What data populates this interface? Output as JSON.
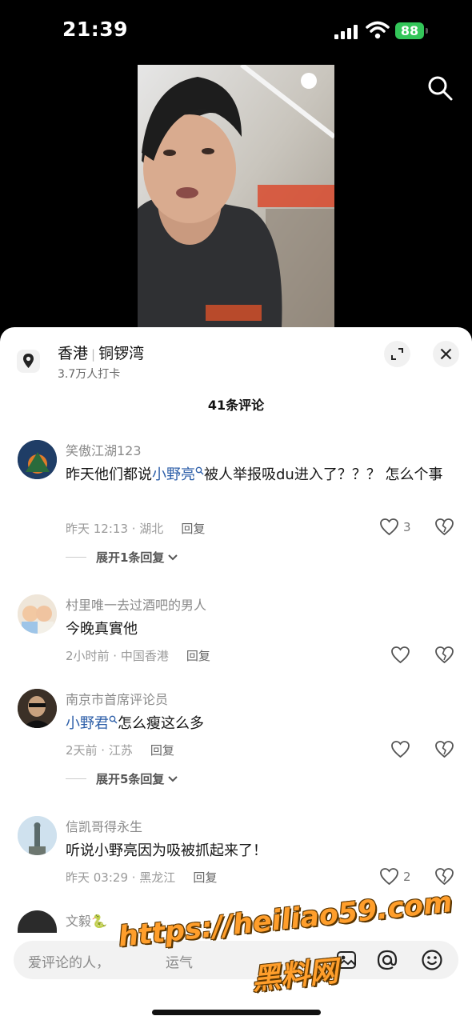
{
  "status": {
    "time": "21:39",
    "battery": "88"
  },
  "location": {
    "city": "香港",
    "district": "铜锣湾",
    "checkins": "3.7万人打卡"
  },
  "comments_title": "41条评论",
  "comments": [
    {
      "user": "笑傲江湖123",
      "text_before": "昨天他们都说",
      "mention": "小野亮",
      "text_after": "被人举报吸du进入了？？？ 怎么个事",
      "time_loc": "昨天 12:13 · 湖北",
      "reply": "回复",
      "likes": "3",
      "expand": "展开1条回复"
    },
    {
      "user": "村里唯一去过酒吧的男人",
      "text": "今晚真實他",
      "time_loc": "2小时前 · 中国香港",
      "reply": "回复"
    },
    {
      "user": "南京市首席评论员",
      "mention": "小野君",
      "text_after": "怎么瘦这么多",
      "time_loc": "2天前 · 江苏",
      "reply": "回复",
      "expand": "展开5条回复"
    },
    {
      "user": "信凯哥得永生",
      "text": "听说小野亮因为吸被抓起来了！",
      "time_loc": "昨天 03:29 · 黑龙江",
      "reply": "回复",
      "likes": "2"
    },
    {
      "user": "文毅🐍"
    }
  ],
  "input": {
    "placeholder": "爱评论的人，",
    "placeholder_tail": "运气"
  },
  "watermark": {
    "url": "https://heiliao59.com",
    "name": "黑料网"
  },
  "icons": [
    "signal-icon",
    "wifi-icon",
    "search-icon",
    "location-pin-icon",
    "expand-icon",
    "close-icon",
    "heart-icon",
    "broken-heart-icon",
    "chevron-down-icon",
    "image-icon",
    "at-icon",
    "emoji-icon"
  ]
}
